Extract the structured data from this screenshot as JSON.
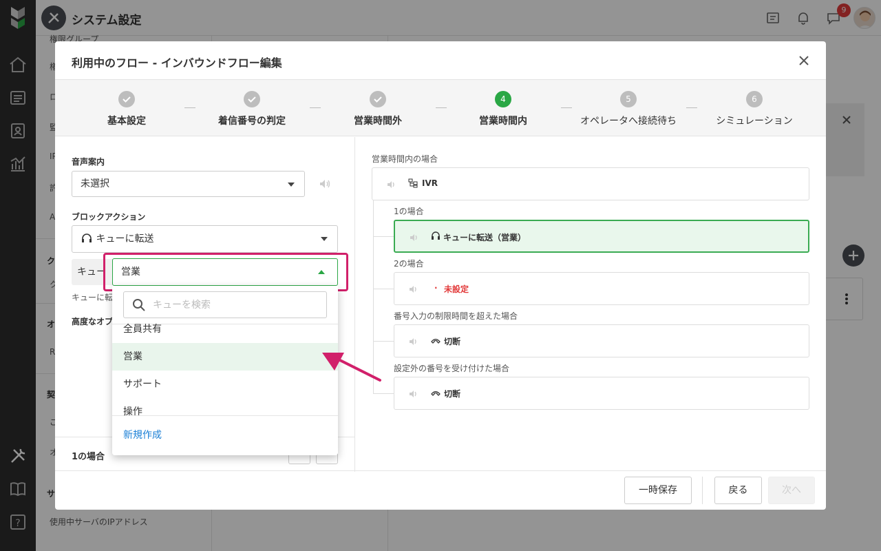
{
  "app": {
    "title": "システム設定",
    "notification_count": "9"
  },
  "background": {
    "sidebar_items": [
      "権限グループ",
      "権",
      "ロ",
      "監",
      "IP",
      "許",
      "A"
    ],
    "sidebar_heads": [
      "ク",
      "ク",
      "オ",
      "R",
      "契",
      "ご",
      "オ",
      "サ"
    ],
    "footer_item": "使用中サーバのIPアドレス"
  },
  "modal": {
    "title": "利用中のフロー - インバウンドフロー編集",
    "steps": [
      {
        "num": "✓",
        "label": "基本設定",
        "state": "done"
      },
      {
        "num": "✓",
        "label": "着信番号の判定",
        "state": "done"
      },
      {
        "num": "✓",
        "label": "営業時間外",
        "state": "done"
      },
      {
        "num": "4",
        "label": "営業時間内",
        "state": "current"
      },
      {
        "num": "5",
        "label": "オペレータへ接続待ち",
        "state": "todo"
      },
      {
        "num": "6",
        "label": "シミュレーション",
        "state": "todo"
      }
    ],
    "form": {
      "voice_label": "音声案内",
      "voice_value": "未選択",
      "block_label": "ブロックアクション",
      "block_value": "キューに転送",
      "queue_label_partial": "キュー",
      "queue_hint_partial": "キューに転",
      "advanced_partial": "高度なオプ",
      "footer_case": "1の場合"
    },
    "tree": {
      "title": "営業時間内の場合",
      "root": "IVR",
      "cases": [
        {
          "label": "1の場合",
          "node": "キューに転送（営業）",
          "type": "queue"
        },
        {
          "label": "2の場合",
          "node": "未設定",
          "type": "unset"
        },
        {
          "label": "番号入力の制限時間を超えた場合",
          "node": "切断",
          "type": "hangup"
        },
        {
          "label": "設定外の番号を受け付けた場合",
          "node": "切断",
          "type": "hangup"
        }
      ]
    },
    "buttons": {
      "save": "一時保存",
      "back": "戻る",
      "next": "次へ"
    }
  },
  "dropdown": {
    "selected": "営業",
    "search_placeholder": "キューを検索",
    "options": [
      "全員共有",
      "営業",
      "サポート",
      "操作"
    ],
    "new_label": "新規作成"
  },
  "colors": {
    "accent": "#2aa745",
    "highlight": "#d1206a",
    "link": "#1a7fd6",
    "error": "#e23b3b"
  }
}
